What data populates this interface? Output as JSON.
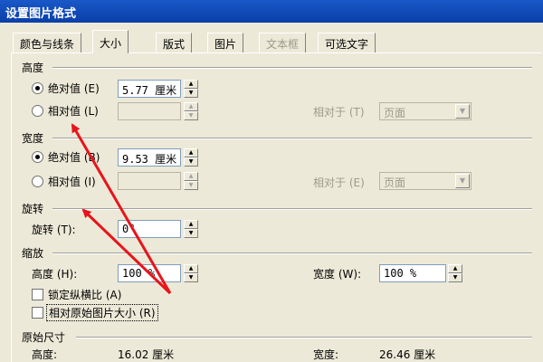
{
  "window": {
    "title": "设置图片格式"
  },
  "tabs": [
    {
      "label": "颜色与线条"
    },
    {
      "label": "大小"
    },
    {
      "label": "版式"
    },
    {
      "label": "图片"
    },
    {
      "label": "文本框"
    },
    {
      "label": "可选文字"
    }
  ],
  "height": {
    "title": "高度",
    "absolute_label": "绝对值 (E)",
    "absolute_value": "5.77 厘米",
    "relative_label": "相对值 (L)",
    "relative_value": "",
    "relative_to_label": "相对于 (T)",
    "relative_to_value": "页面"
  },
  "width": {
    "title": "宽度",
    "absolute_label": "绝对值 (B)",
    "absolute_value": "9.53 厘米",
    "relative_label": "相对值 (I)",
    "relative_value": "",
    "relative_to_label": "相对于 (E)",
    "relative_to_value": "页面"
  },
  "rotation": {
    "title": "旋转",
    "label": "旋转 (T):",
    "value": "0°"
  },
  "scale": {
    "title": "缩放",
    "height_label": "高度 (H):",
    "height_value": "100 %",
    "width_label": "宽度 (W):",
    "width_value": "100 %",
    "lock_aspect_label": "锁定纵横比 (A)",
    "lock_aspect_checked": false,
    "relative_original_label": "相对原始图片大小 (R)",
    "relative_original_checked": false
  },
  "original_size": {
    "title": "原始尺寸",
    "height_label": "高度:",
    "height_value": "16.02 厘米",
    "width_label": "宽度:",
    "width_value": "26.46 厘米"
  },
  "annotation_color": "#E8141B"
}
